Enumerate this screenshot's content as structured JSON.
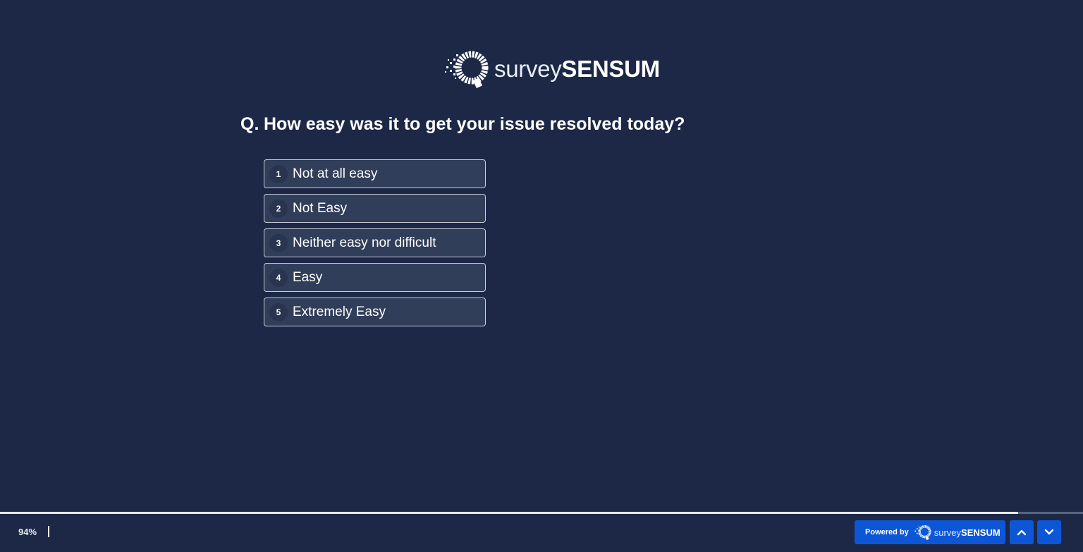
{
  "brand": {
    "name_light": "survey",
    "name_bold": "SENSUM"
  },
  "question": {
    "prefix": "Q.",
    "text": "How easy was it to get your issue resolved today?"
  },
  "options": [
    {
      "key": "1",
      "label": "Not at all easy"
    },
    {
      "key": "2",
      "label": "Not Easy"
    },
    {
      "key": "3",
      "label": "Neither easy nor difficult"
    },
    {
      "key": "4",
      "label": "Easy"
    },
    {
      "key": "5",
      "label": "Extremely Easy"
    }
  ],
  "footer": {
    "progress_text": "94%",
    "progress_value": 0.94,
    "powered_by_label": "Powered by",
    "powered_brand_light": "survey",
    "powered_brand_bold": "SENSUM",
    "nav_up_icon": "chevron-up-icon",
    "nav_down_icon": "chevron-down-icon"
  },
  "colors": {
    "background": "#1c2846",
    "option_bg": "#313e5a",
    "accent_blue": "#0d57d6"
  }
}
